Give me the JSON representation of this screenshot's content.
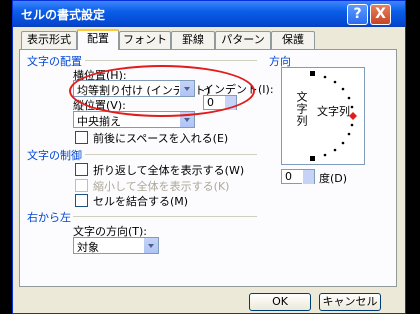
{
  "window": {
    "title": "セルの書式設定",
    "help": "?",
    "close": "X"
  },
  "tabs": [
    "表示形式",
    "配置",
    "フォント",
    "罫線",
    "パターン",
    "保護"
  ],
  "active_tab": "配置",
  "alignment": {
    "group": "文字の配置",
    "horizontal_label": "横位置(H):",
    "horizontal_value": "均等割り付け (インデント)",
    "indent_label": "インデント(I):",
    "indent_value": "0",
    "vertical_label": "縦位置(V):",
    "vertical_value": "中央揃え",
    "space_label": "前後にスペースを入れる(E)"
  },
  "control": {
    "group": "文字の制御",
    "wrap": "折り返して全体を表示する(W)",
    "shrink": "縮小して全体を表示する(K)",
    "merge": "セルを結合する(M)"
  },
  "rtl": {
    "group": "右から左",
    "direction_label": "文字の方向(T):",
    "direction_value": "対象"
  },
  "orientation": {
    "group": "方向",
    "vertical_text": "文字列",
    "horizontal_text": "文字列",
    "degree_value": "0",
    "degree_label": "度(D)"
  },
  "buttons": {
    "ok": "OK",
    "cancel": "キャンセル"
  }
}
